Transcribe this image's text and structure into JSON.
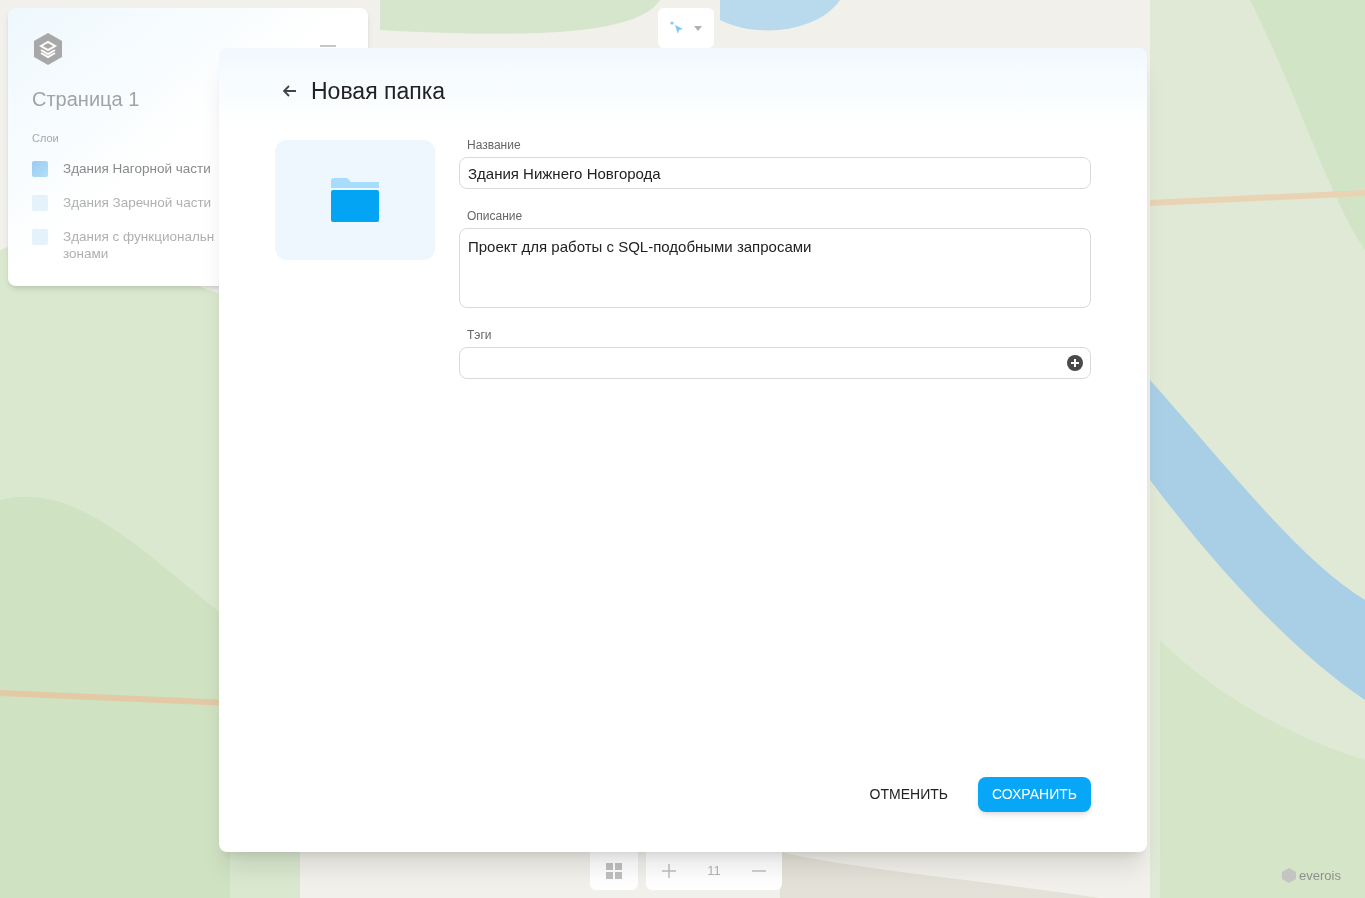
{
  "sidebar": {
    "title": "Страница 1",
    "section": "Слои",
    "layers": [
      {
        "lines": [
          "Здания Нагорной части"
        ],
        "visible": true
      },
      {
        "lines": [
          "Здания Заречной части"
        ],
        "visible": false
      },
      {
        "lines": [
          "Здания с функциональн",
          "зонами"
        ],
        "visible": false
      }
    ]
  },
  "zoom": {
    "level": "11"
  },
  "brand": "everois",
  "dialog": {
    "title": "Новая папка",
    "fields": [
      {
        "kind": "input",
        "label": "Название",
        "value": "Здания Нижнего Новгорода"
      },
      {
        "kind": "textarea",
        "label": "Описание",
        "value": "Проект для работы с SQL-подобными запросами"
      },
      {
        "kind": "tags",
        "label": "Тэги"
      }
    ],
    "buttons": [
      {
        "kind": "text",
        "label": "ОТМЕНИТЬ"
      },
      {
        "kind": "primary",
        "label": "СОХРАНИТЬ"
      }
    ]
  }
}
